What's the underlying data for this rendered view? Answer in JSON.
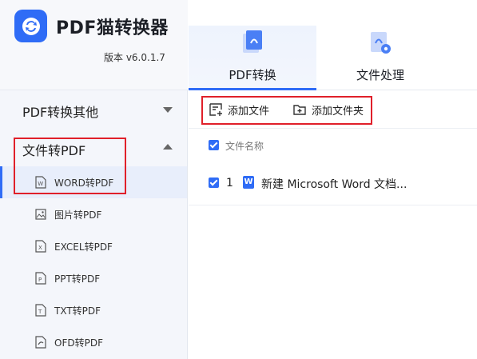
{
  "app": {
    "name": "PDF猫转换器",
    "version": "版本 v6.0.1.7"
  },
  "sidebar": {
    "categories": [
      {
        "label": "PDF转换其他",
        "state": "collapsed"
      },
      {
        "label": "文件转PDF",
        "state": "expanded"
      }
    ],
    "items": [
      {
        "label": "WORD转PDF",
        "icon": "word-file-icon",
        "active": true
      },
      {
        "label": "图片转PDF",
        "icon": "image-file-icon"
      },
      {
        "label": "EXCEL转PDF",
        "icon": "excel-file-icon"
      },
      {
        "label": "PPT转PDF",
        "icon": "ppt-file-icon"
      },
      {
        "label": "TXT转PDF",
        "icon": "txt-file-icon"
      },
      {
        "label": "OFD转PDF",
        "icon": "ofd-file-icon"
      }
    ]
  },
  "tabs": [
    {
      "label": "PDF转换",
      "icon": "pdf-convert-icon",
      "active": true
    },
    {
      "label": "文件处理",
      "icon": "file-process-icon",
      "active": false
    }
  ],
  "toolbar": {
    "add_file": "添加文件",
    "add_folder": "添加文件夹"
  },
  "file_list": {
    "header": "文件名称",
    "rows": [
      {
        "index": "1",
        "name": "新建 Microsoft Word 文档...",
        "checked": true
      }
    ]
  },
  "colors": {
    "accent": "#2f6cf6",
    "highlight_border": "#e0202a"
  }
}
